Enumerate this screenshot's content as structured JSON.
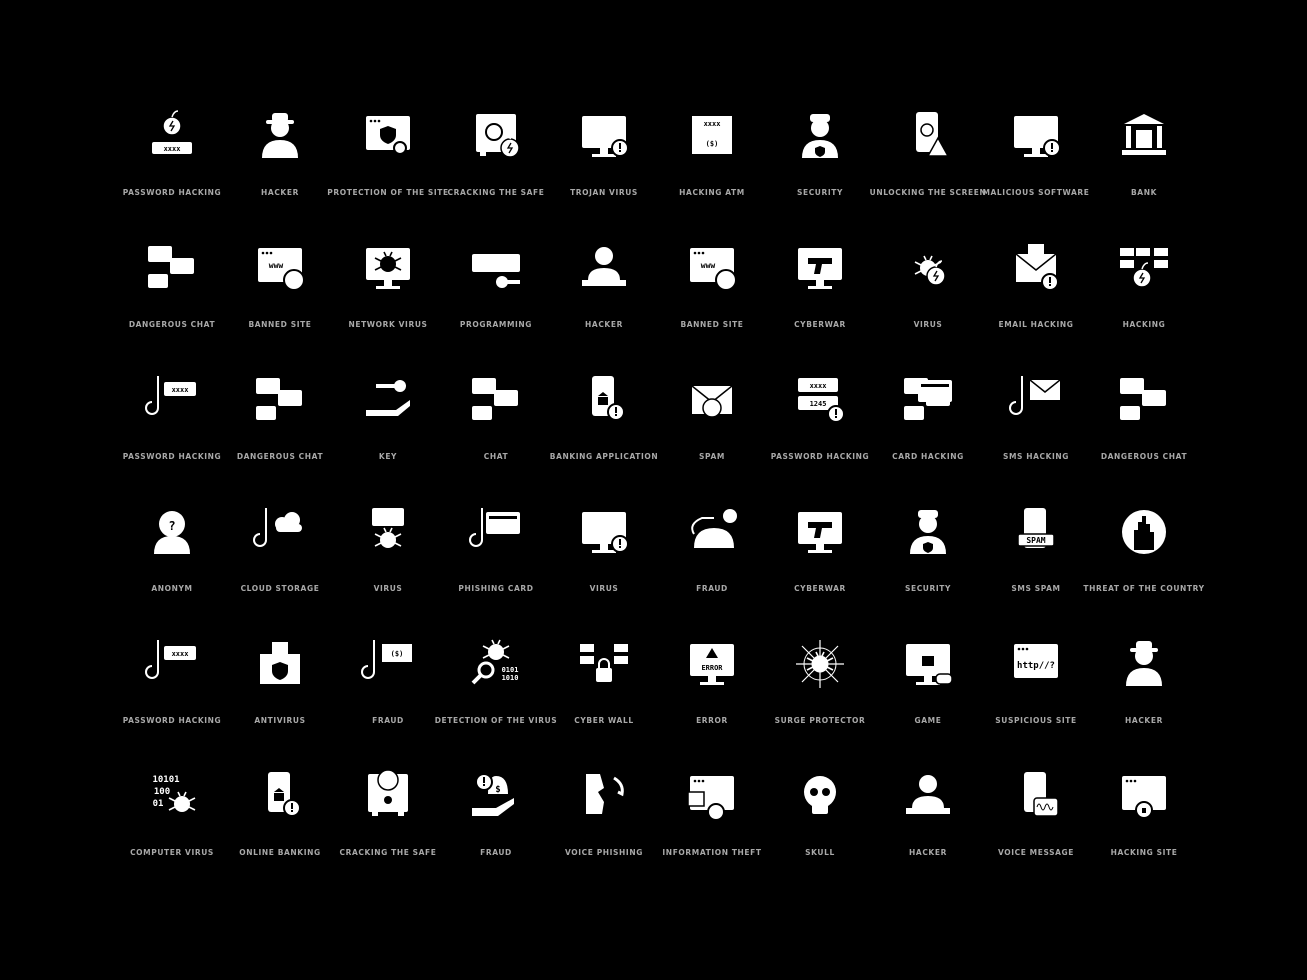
{
  "colors": {
    "background": "#000000",
    "icon": "#ffffff",
    "label": "#a8a8a8"
  },
  "rows": [
    [
      {
        "label": "PASSWORD HACKING",
        "icon": "bomb-password"
      },
      {
        "label": "HACKER",
        "icon": "hacker-hat"
      },
      {
        "label": "PROTECTION OF THE SITE",
        "icon": "browser-shield"
      },
      {
        "label": "CRACKING THE SAFE",
        "icon": "safe-bomb"
      },
      {
        "label": "TROJAN VIRUS",
        "icon": "monitor-alert"
      },
      {
        "label": "HACKING ATM",
        "icon": "atm"
      },
      {
        "label": "SECURITY",
        "icon": "guard"
      },
      {
        "label": "UNLOCKING THE SCREEN",
        "icon": "phone-fingerprint"
      },
      {
        "label": "MALICIOUS SOFTWARE",
        "icon": "monitor-alert"
      },
      {
        "label": "BANK",
        "icon": "bank"
      }
    ],
    [
      {
        "label": "DANGEROUS CHAT",
        "icon": "chat"
      },
      {
        "label": "BANNED SITE",
        "icon": "browser-hand"
      },
      {
        "label": "NETWORK VIRUS",
        "icon": "monitor-bug"
      },
      {
        "label": "PROGRAMMING",
        "icon": "keyboard"
      },
      {
        "label": "HACKER",
        "icon": "hacker-laptop"
      },
      {
        "label": "BANNED SITE",
        "icon": "browser-hand"
      },
      {
        "label": "CYBERWAR",
        "icon": "monitor-gun"
      },
      {
        "label": "VIRUS",
        "icon": "bug"
      },
      {
        "label": "EMAIL HACKING",
        "icon": "envelope-alert"
      },
      {
        "label": "HACKING",
        "icon": "wall-bomb"
      }
    ],
    [
      {
        "label": "PASSWORD HACKING",
        "icon": "hook-password"
      },
      {
        "label": "DANGEROUS CHAT",
        "icon": "chat"
      },
      {
        "label": "KEY",
        "icon": "hand-key"
      },
      {
        "label": "CHAT",
        "icon": "chat"
      },
      {
        "label": "BANKING APPLICATION",
        "icon": "phone-bank"
      },
      {
        "label": "SPAM",
        "icon": "envelope-skull"
      },
      {
        "label": "PASSWORD HACKING",
        "icon": "password-alert"
      },
      {
        "label": "CARD HACKING",
        "icon": "chat-card"
      },
      {
        "label": "SMS HACKING",
        "icon": "hook-envelope"
      },
      {
        "label": "DANGEROUS CHAT",
        "icon": "chat"
      }
    ],
    [
      {
        "label": "ANONYM",
        "icon": "anonym"
      },
      {
        "label": "CLOUD STORAGE",
        "icon": "hook-cloud"
      },
      {
        "label": "VIRUS",
        "icon": "card-bug"
      },
      {
        "label": "PHISHING CARD",
        "icon": "hook-card"
      },
      {
        "label": "VIRUS",
        "icon": "monitor-alert"
      },
      {
        "label": "FRAUD",
        "icon": "mouse-money"
      },
      {
        "label": "CYBERWAR",
        "icon": "monitor-gun"
      },
      {
        "label": "SECURITY",
        "icon": "guard"
      },
      {
        "label": "SMS SPAM",
        "icon": "phone-spam"
      },
      {
        "label": "THREAT OF THE COUNTRY",
        "icon": "city-alert"
      }
    ],
    [
      {
        "label": "PASSWORD HACKING",
        "icon": "hook-password"
      },
      {
        "label": "ANTIVIRUS",
        "icon": "castle-shield"
      },
      {
        "label": "FRAUD",
        "icon": "hook-money"
      },
      {
        "label": "DETECTION OF THE VIRUS",
        "icon": "magnifier-bug"
      },
      {
        "label": "CYBER WALL",
        "icon": "wall-lock"
      },
      {
        "label": "ERROR",
        "icon": "monitor-error"
      },
      {
        "label": "SURGE PROTECTOR",
        "icon": "web-spider"
      },
      {
        "label": "GAME",
        "icon": "monitor-lock"
      },
      {
        "label": "SUSPICIOUS SITE",
        "icon": "browser-http"
      },
      {
        "label": "HACKER",
        "icon": "hacker-hat"
      }
    ],
    [
      {
        "label": "COMPUTER VIRUS",
        "icon": "binary-bug"
      },
      {
        "label": "ONLINE BANKING",
        "icon": "phone-bank"
      },
      {
        "label": "CRACKING THE SAFE",
        "icon": "safe-skull"
      },
      {
        "label": "FRAUD",
        "icon": "hand-money"
      },
      {
        "label": "VOICE PHISHING",
        "icon": "voice-phone"
      },
      {
        "label": "INFORMATION THEFT",
        "icon": "browser-info"
      },
      {
        "label": "SKULL",
        "icon": "skull"
      },
      {
        "label": "HACKER",
        "icon": "hacker-laptop"
      },
      {
        "label": "VOICE MESSAGE",
        "icon": "phone-wave"
      },
      {
        "label": "HACKING SITE",
        "icon": "browser-lock"
      }
    ]
  ]
}
